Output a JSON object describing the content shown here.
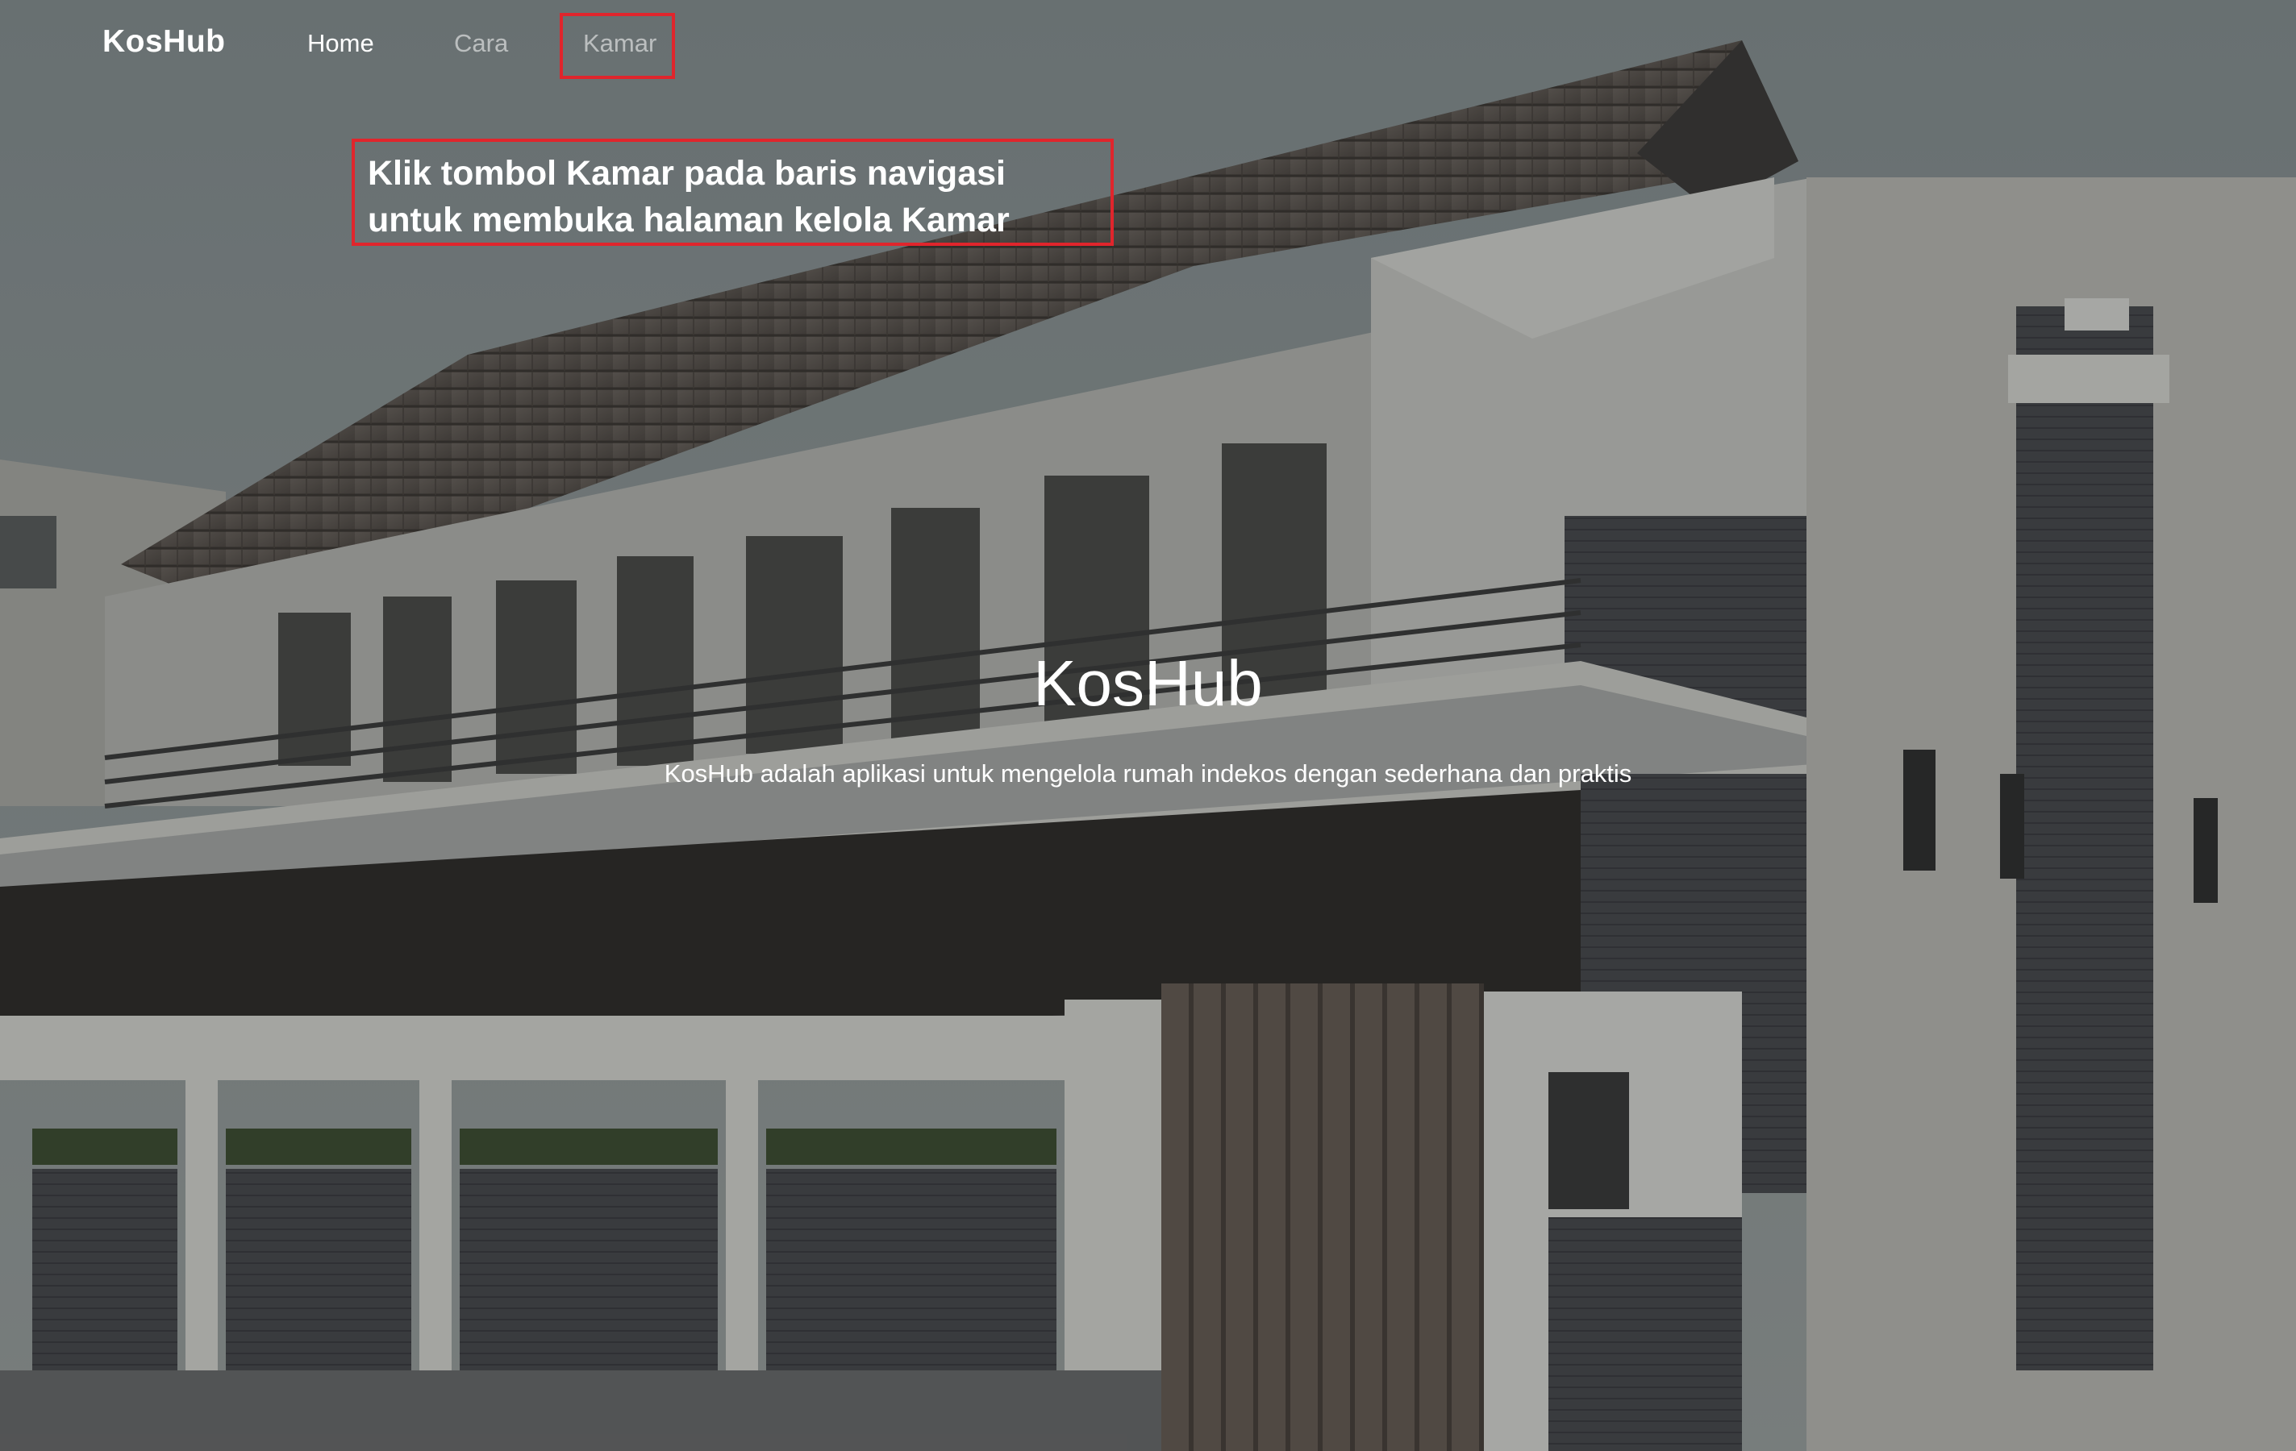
{
  "navbar": {
    "brand": "KosHub",
    "items": [
      {
        "label": "Home",
        "state": "active"
      },
      {
        "label": "Cara",
        "state": "inactive"
      },
      {
        "label": "Kamar",
        "state": "inactive",
        "highlighted": true
      }
    ]
  },
  "annotation": {
    "callout_text": "Klik tombol Kamar pada baris navigasi untuk membuka halaman kelola Kamar",
    "highlight_color": "#e0252c"
  },
  "hero": {
    "title": "KosHub",
    "subtitle": "KosHub adalah aplikasi untuk mengelola rumah indekos dengan sederhana dan praktis"
  },
  "colors": {
    "text": "#ffffff",
    "muted_nav": "rgba(255,255,255,0.55)"
  }
}
